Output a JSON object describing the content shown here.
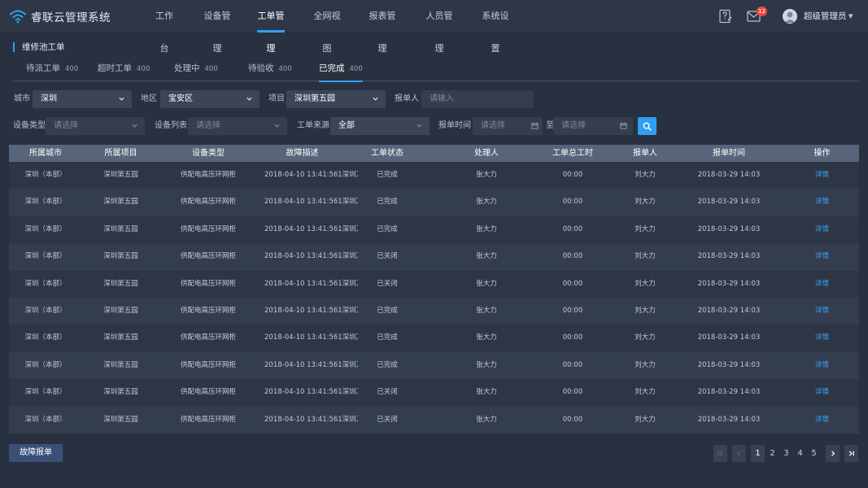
{
  "app": {
    "title": "睿联云管理系统",
    "accent": "#2f9ff4"
  },
  "nav": {
    "items": [
      {
        "label": "工作台"
      },
      {
        "label": "设备管理"
      },
      {
        "label": "工单管理",
        "active": true
      },
      {
        "label": "全网视图"
      },
      {
        "label": "报表管理"
      },
      {
        "label": "人员管理"
      },
      {
        "label": "系统设置"
      }
    ]
  },
  "header": {
    "mail_badge": "12",
    "user_name": "超级管理员"
  },
  "section": {
    "title": "维修池工单"
  },
  "tabs": [
    {
      "label": "待派工单",
      "count": "400"
    },
    {
      "label": "超时工单",
      "count": "400"
    },
    {
      "label": "处理中",
      "count": "400"
    },
    {
      "label": "待验收",
      "count": "400"
    },
    {
      "label": "已完成",
      "count": "400",
      "active": true
    }
  ],
  "filters": {
    "city": {
      "label": "城市",
      "value": "深圳"
    },
    "region": {
      "label": "地区",
      "value": "宝安区"
    },
    "project": {
      "label": "项目",
      "value": "深圳第五园"
    },
    "reporter": {
      "label": "报单人",
      "placeholder": "请输入"
    },
    "device_type": {
      "label": "设备类型",
      "placeholder": "请选择"
    },
    "device_list": {
      "label": "设备列表",
      "placeholder": "请选择"
    },
    "source": {
      "label": "工单来源",
      "value": "全部"
    },
    "report_time": {
      "label": "报单时间",
      "start_placeholder": "请选择",
      "separator": "至",
      "end_placeholder": "请选择"
    }
  },
  "table": {
    "columns": [
      "所属城市",
      "所属项目",
      "设备类型",
      "故障描述",
      "工单状态",
      "处理人",
      "工单总工时",
      "报单人",
      "报单时间",
      "操作"
    ],
    "rows": [
      [
        "深圳（本部）",
        "深圳第五园",
        "供配电高压环网柜",
        "2018-04-10 13:41:561深圳万...",
        "已完成",
        "张大力",
        "00:00",
        "刘大力",
        "2018-03-29 14:03",
        "详情"
      ],
      [
        "深圳（本部）",
        "深圳第五园",
        "供配电高压环网柜",
        "2018-04-10 13:41:561深圳万...",
        "已完成",
        "张大力",
        "00:00",
        "刘大力",
        "2018-03-29 14:03",
        "详情"
      ],
      [
        "深圳（本部）",
        "深圳第五园",
        "供配电高压环网柜",
        "2018-04-10 13:41:561深圳万...",
        "已完成",
        "张大力",
        "00:00",
        "刘大力",
        "2018-03-29 14:03",
        "详情"
      ],
      [
        "深圳（本部）",
        "深圳第五园",
        "供配电高压环网柜",
        "2018-04-10 13:41:561深圳万...",
        "已关闭",
        "张大力",
        "00:00",
        "刘大力",
        "2018-03-29 14:03",
        "详情"
      ],
      [
        "深圳（本部）",
        "深圳第五园",
        "供配电高压环网柜",
        "2018-04-10 13:41:561深圳万...",
        "已关闭",
        "张大力",
        "00:00",
        "刘大力",
        "2018-03-29 14:03",
        "详情"
      ],
      [
        "深圳（本部）",
        "深圳第五园",
        "供配电高压环网柜",
        "2018-04-10 13:41:561深圳万...",
        "已完成",
        "张大力",
        "00:00",
        "刘大力",
        "2018-03-29 14:03",
        "详情"
      ],
      [
        "深圳（本部）",
        "深圳第五园",
        "供配电高压环网柜",
        "2018-04-10 13:41:561深圳万...",
        "已完成",
        "张大力",
        "00:00",
        "刘大力",
        "2018-03-29 14:03",
        "详情"
      ],
      [
        "深圳（本部）",
        "深圳第五园",
        "供配电高压环网柜",
        "2018-04-10 13:41:561深圳万...",
        "已完成",
        "张大力",
        "00:00",
        "刘大力",
        "2018-03-29 14:03",
        "详情"
      ],
      [
        "深圳（本部）",
        "深圳第五园",
        "供配电高压环网柜",
        "2018-04-10 13:41:561深圳万...",
        "已关闭",
        "张大力",
        "00:00",
        "刘大力",
        "2018-03-29 14:03",
        "详情"
      ],
      [
        "深圳（本部）",
        "深圳第五园",
        "供配电高压环网柜",
        "2018-04-10 13:41:561深圳万...",
        "已关闭",
        "张大力",
        "00:00",
        "刘大力",
        "2018-03-29 14:03",
        "详情"
      ]
    ]
  },
  "footer": {
    "report_button": "故障报单",
    "pagination": {
      "pages": [
        "1",
        "2",
        "3",
        "4",
        "5"
      ],
      "current": "1"
    }
  }
}
